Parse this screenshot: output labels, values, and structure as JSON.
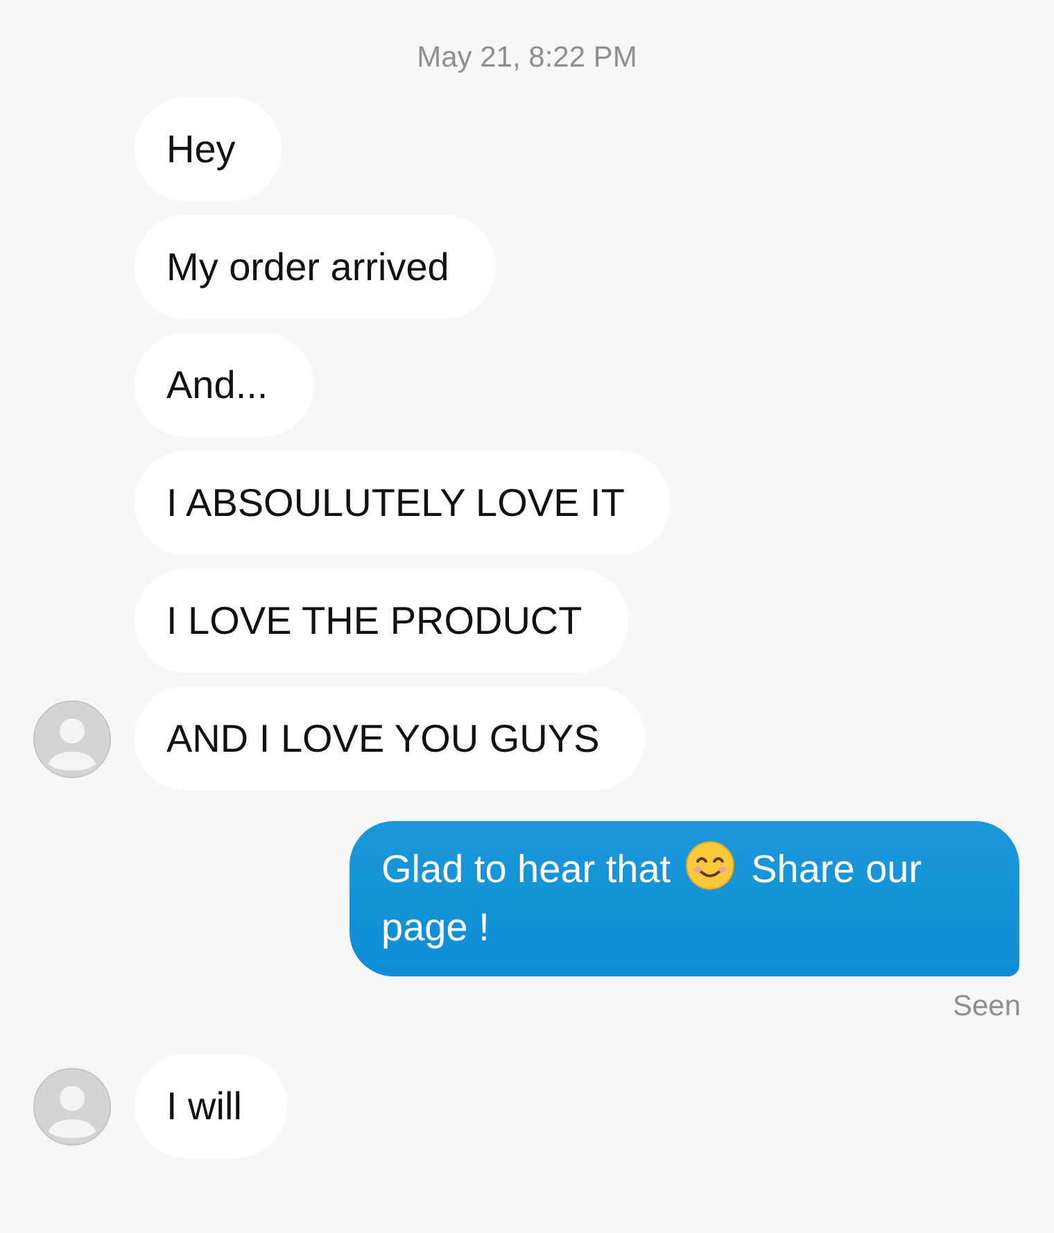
{
  "timestamp": "May 21, 8:22 PM",
  "messages": [
    {
      "kind": "incoming",
      "avatar": false,
      "parts": [
        {
          "kind": "text",
          "text": "Hey"
        }
      ]
    },
    {
      "kind": "incoming",
      "avatar": false,
      "parts": [
        {
          "kind": "text",
          "text": "My order arrived"
        }
      ]
    },
    {
      "kind": "incoming",
      "avatar": false,
      "parts": [
        {
          "kind": "text",
          "text": "And..."
        }
      ]
    },
    {
      "kind": "incoming",
      "avatar": false,
      "parts": [
        {
          "kind": "text",
          "text": "I ABSOULUTELY LOVE IT"
        }
      ]
    },
    {
      "kind": "incoming",
      "avatar": false,
      "parts": [
        {
          "kind": "text",
          "text": "I LOVE THE PRODUCT"
        }
      ]
    },
    {
      "kind": "incoming",
      "avatar": true,
      "parts": [
        {
          "kind": "text",
          "text": "AND I LOVE YOU GUYS"
        }
      ]
    },
    {
      "kind": "outgoing",
      "parts": [
        {
          "kind": "text",
          "text": "Glad to hear that"
        },
        {
          "kind": "emoji"
        },
        {
          "kind": "text",
          "text": "Share our page !"
        }
      ],
      "status": "Seen"
    },
    {
      "kind": "incoming",
      "avatar": true,
      "parts": [
        {
          "kind": "text",
          "text": "I will"
        }
      ]
    }
  ]
}
